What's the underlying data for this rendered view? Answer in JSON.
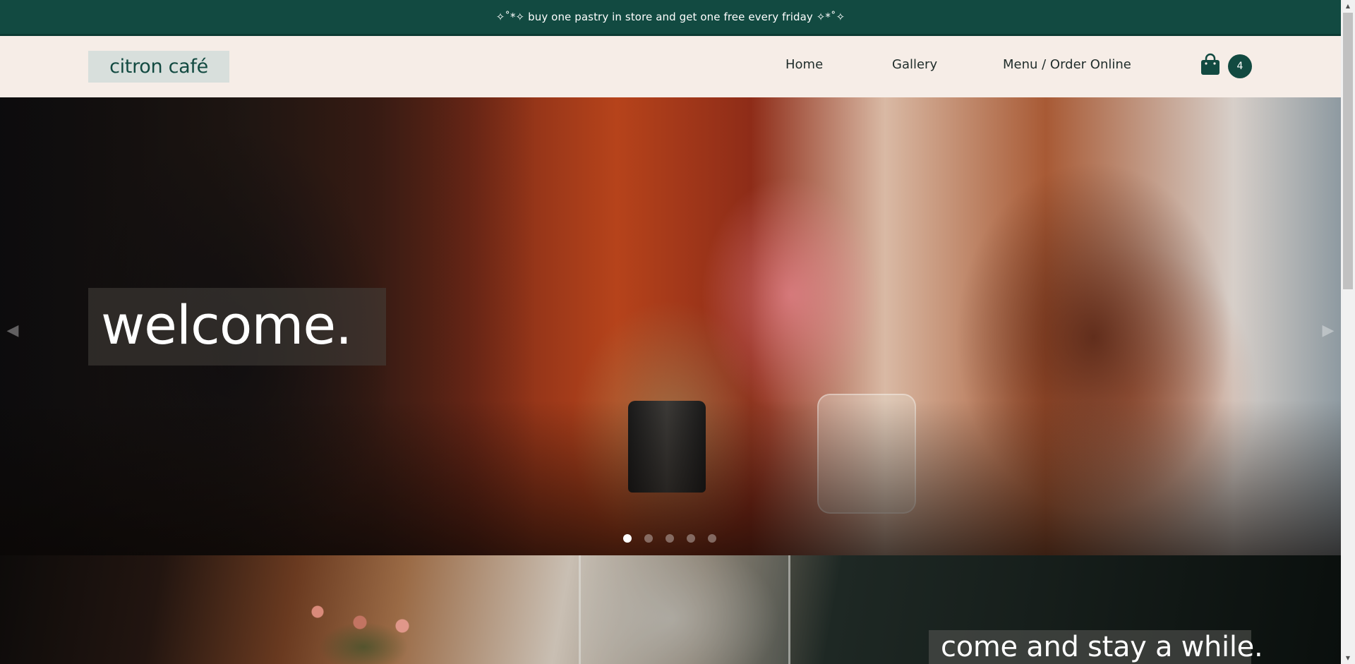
{
  "announcement": {
    "text": "✧˚*✧ buy one pastry in store and get one free every friday ✧*˚✧"
  },
  "header": {
    "logo": "citron café",
    "nav": [
      {
        "label": "Home"
      },
      {
        "label": "Gallery"
      },
      {
        "label": "Menu / Order Online"
      }
    ],
    "cart": {
      "icon": "shopping-bag-icon",
      "count": "4"
    }
  },
  "hero": {
    "headline": "welcome.",
    "slides_total": 5,
    "active_slide": 1,
    "prev_icon": "chevron-left-icon",
    "next_icon": "chevron-right-icon"
  },
  "section2": {
    "headline": "come and stay a while."
  },
  "colors": {
    "brand_green": "#124a41",
    "header_bg": "#f6ede7",
    "logo_bg": "#d8dfdc"
  }
}
